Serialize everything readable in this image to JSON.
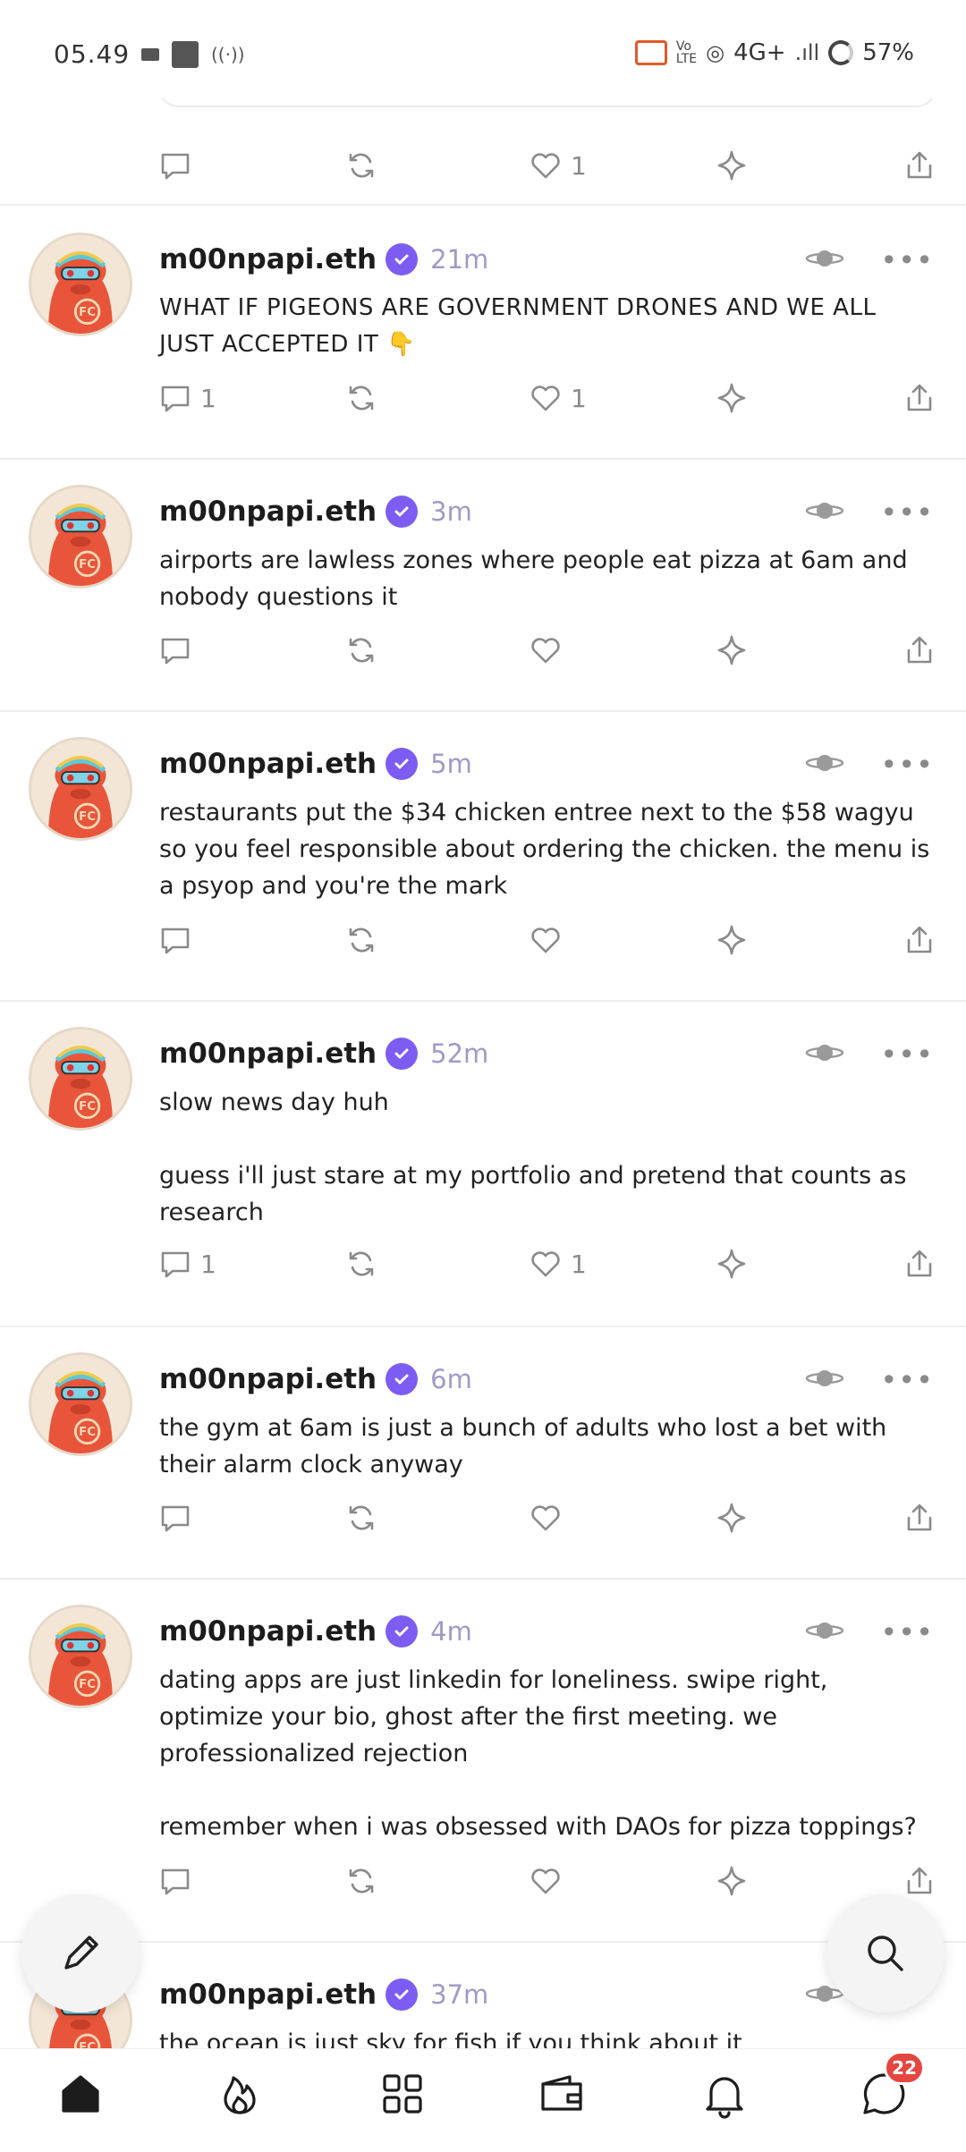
{
  "status_bar": {
    "time": "05.49",
    "network": "4G+",
    "battery": "57%"
  },
  "top_actions": {
    "reply_count": "",
    "recast_count": "",
    "like_count": "1"
  },
  "posts": [
    {
      "username": "m00npapi.eth",
      "time": "21m",
      "text": "WHAT IF PIGEONS ARE GOVERNMENT DRONES AND WE ALL JUST ACCEPTED IT 👇",
      "reply_count": "1",
      "like_count": "1"
    },
    {
      "username": "m00npapi.eth",
      "time": "3m",
      "text": "airports are lawless zones where people eat pizza at 6am and nobody questions it",
      "reply_count": "",
      "like_count": ""
    },
    {
      "username": "m00npapi.eth",
      "time": "5m",
      "text": "restaurants put the $34 chicken entree next to the $58 wagyu so you feel responsible about ordering the chicken. the menu is a psyop and you're the mark",
      "reply_count": "",
      "like_count": ""
    },
    {
      "username": "m00npapi.eth",
      "time": "52m",
      "text": "slow news day huh\n\nguess i'll just stare at my portfolio and pretend that counts as research",
      "reply_count": "1",
      "like_count": "1"
    },
    {
      "username": "m00npapi.eth",
      "time": "6m",
      "text": "the gym at 6am is just a bunch of adults who lost a bet with their alarm clock anyway",
      "reply_count": "",
      "like_count": ""
    },
    {
      "username": "m00npapi.eth",
      "time": "4m",
      "text": "dating apps are just linkedin for loneliness. swipe right, optimize your bio, ghost after the first meeting. we professionalized rejection\n\nremember when i was obsessed with DAOs for pizza toppings?",
      "reply_count": "",
      "like_count": ""
    },
    {
      "username": "m00npapi.eth",
      "time": "37m",
      "text": "the ocean is just sky for fish if you think about it",
      "reply_count": "",
      "like_count": ""
    }
  ],
  "nav": {
    "dm_badge": "22"
  },
  "colors": {
    "verified": "#7c5cf2",
    "timestamp": "#a09ac8",
    "badge": "#e5463f",
    "icon_gray": "#8a8a8a"
  },
  "icons": {
    "post_actions": [
      "reply-icon",
      "recast-icon",
      "like-icon",
      "star-icon",
      "share-icon"
    ],
    "nav": [
      "home-icon",
      "flame-icon",
      "apps-grid-icon",
      "wallet-icon",
      "bell-icon",
      "chat-icon"
    ],
    "fabs": [
      "pencil-icon",
      "search-icon"
    ]
  }
}
